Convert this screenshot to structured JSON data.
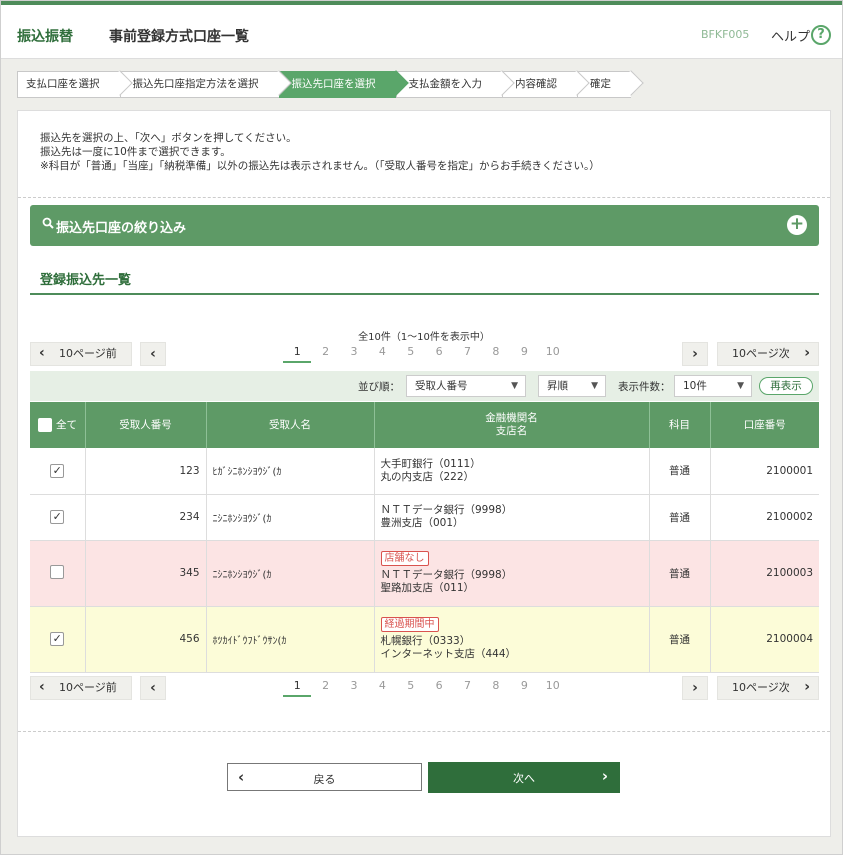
{
  "header": {
    "category": "振込振替",
    "title": "事前登録方式口座一覧",
    "screen_code": "BFKF005",
    "help_label": "ヘルプ",
    "help_icon": "?"
  },
  "steps": [
    {
      "label": "支払口座を選択",
      "active": false
    },
    {
      "label": "振込先口座指定方法を選択",
      "active": false
    },
    {
      "label": "振込先口座を選択",
      "active": true
    },
    {
      "label": "支払金額を入力",
      "active": false
    },
    {
      "label": "内容確認",
      "active": false
    },
    {
      "label": "確定",
      "active": false
    }
  ],
  "instructions": {
    "line1": "振込先を選択の上、「次へ」ボタンを押してください。",
    "line2": "振込先は一度に10件まで選択できます。",
    "line3": "※科目が「普通」「当座」「納税準備」以外の振込先は表示されません。（「受取人番号を指定」からお手続きください。）"
  },
  "filter": {
    "label": "振込先口座の絞り込み",
    "icon": "search-icon",
    "toggle": "+"
  },
  "section_title": "登録振込先一覧",
  "pagination": {
    "summary": "全10件（1〜10件を表示中）",
    "prev10": "10ページ前",
    "next10": "10ページ次",
    "prev_arrow": "‹",
    "next_arrow": "›",
    "pages": [
      "1",
      "2",
      "3",
      "4",
      "5",
      "6",
      "7",
      "8",
      "9",
      "10"
    ],
    "current": "1"
  },
  "sort": {
    "order_label": "並び順：",
    "order_value": "受取人番号",
    "direction_value": "昇順",
    "count_label": "表示件数：",
    "count_value": "10件",
    "redisplay": "再表示"
  },
  "table": {
    "headers": {
      "all": "全て",
      "recipient_no": "受取人番号",
      "recipient_name": "受取人名",
      "bank_line1": "金融機関名",
      "bank_line2": "支店名",
      "subject": "科目",
      "account": "口座番号"
    },
    "rows": [
      {
        "checked": "✓",
        "no": "123",
        "name": "ﾋｶﾞｼﾆﾎﾝｼﾖｳｼﾞ(ｶ",
        "badge": "",
        "bank": "大手町銀行（0111）",
        "branch": "丸の内支店（222）",
        "subject": "普通",
        "account": "2100001",
        "bg": "#ffffff"
      },
      {
        "checked": "✓",
        "no": "234",
        "name": "ﾆｼﾆﾎﾝｼﾖｳｼﾞ(ｶ",
        "badge": "",
        "bank": "ＮＴＴデータ銀行（9998）",
        "branch": "豊洲支店（001）",
        "subject": "普通",
        "account": "2100002",
        "bg": "#ffffff"
      },
      {
        "checked": "",
        "no": "345",
        "name": "ﾆｼﾆﾎﾝｼﾖｳｼﾞ(ｶ",
        "badge": "店舗なし",
        "bank": "ＮＴＴデータ銀行（9998）",
        "branch": "聖路加支店（011）",
        "subject": "普通",
        "account": "2100003",
        "bg": "#fce4e4"
      },
      {
        "checked": "✓",
        "no": "456",
        "name": "ﾎﾂｶｲﾄﾞｳﾌﾄﾞｳｻﾝ(ｶ",
        "badge": "経過期間中",
        "bank": "札幌銀行（0333）",
        "branch": "インターネット支店（444）",
        "subject": "普通",
        "account": "2100004",
        "bg": "#fcfcd8"
      }
    ]
  },
  "buttons": {
    "back": "戻る",
    "next": "次へ",
    "back_arrow": "‹",
    "next_arrow": "›"
  },
  "colors": {
    "primary": "#5e9a66",
    "dark_green": "#2f6e3b",
    "warning_row": "#fce4e4",
    "caution_row": "#fcfcd8",
    "badge_red": "#d9534f"
  }
}
